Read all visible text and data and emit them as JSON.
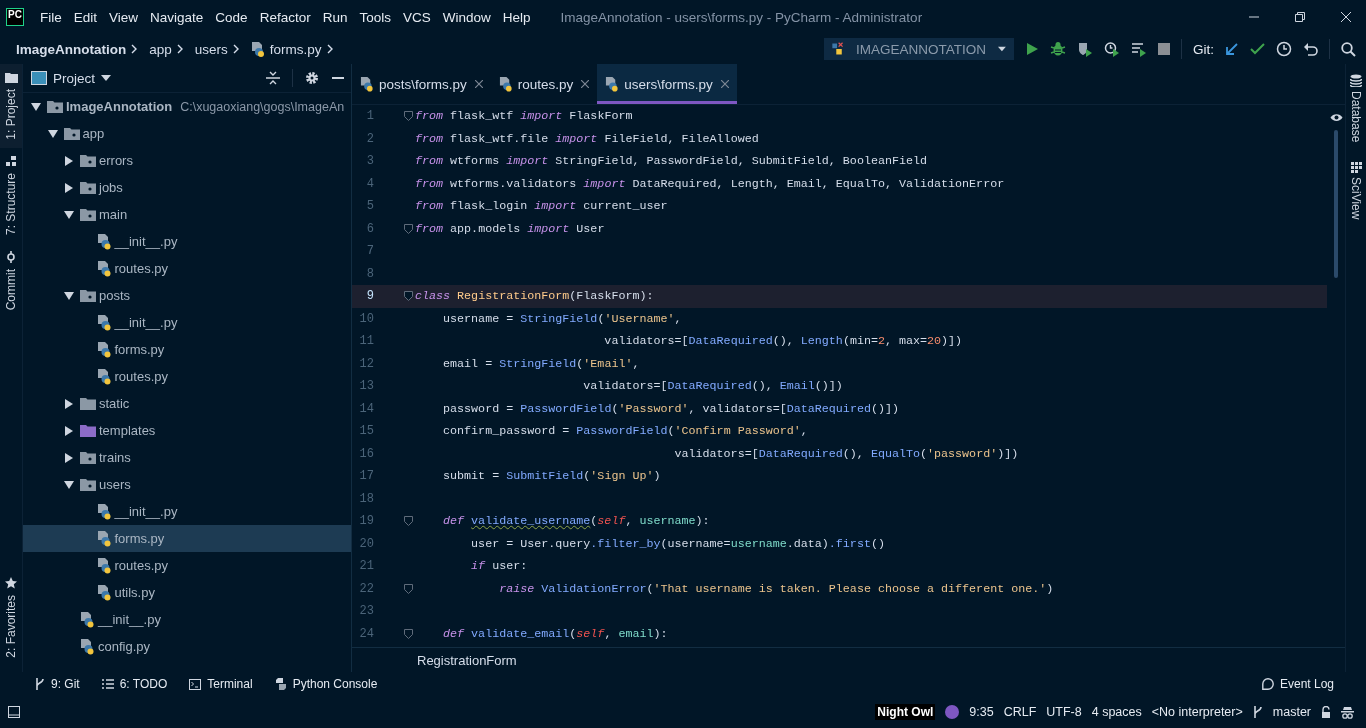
{
  "window": {
    "logo": "PC",
    "title": "ImageAnnotation - users\\forms.py - PyCharm - Administrator"
  },
  "menu": [
    "File",
    "Edit",
    "View",
    "Navigate",
    "Code",
    "Refactor",
    "Run",
    "Tools",
    "VCS",
    "Window",
    "Help"
  ],
  "breadcrumbs": [
    {
      "text": "ImageAnnotation",
      "kind": "project"
    },
    {
      "text": "app",
      "kind": "folder"
    },
    {
      "text": "users",
      "kind": "folder"
    },
    {
      "text": "forms.py",
      "kind": "py"
    }
  ],
  "run_config": "IMAGEANNOTATION",
  "git_label": "Git:",
  "left_strip": [
    {
      "label": "1: Project",
      "kind": "folder",
      "selected": true
    },
    {
      "label": "7: Structure",
      "kind": "structure",
      "selected": false
    },
    {
      "label": "Commit",
      "kind": "commit",
      "selected": false
    }
  ],
  "left_strip_bottom": [
    {
      "label": "2: Favorites",
      "kind": "star",
      "selected": false
    }
  ],
  "right_strip": [
    {
      "label": "Database",
      "kind": "database"
    },
    {
      "label": "SciView",
      "kind": "sciview"
    }
  ],
  "project": {
    "title": "Project",
    "tree": [
      {
        "name": "ImageAnnotation",
        "path": "C:\\xugaoxiang\\gogs\\ImageAn",
        "kind": "root",
        "expanded": true,
        "selected": false,
        "children": [
          {
            "name": "app",
            "kind": "package",
            "expanded": true,
            "selected": false,
            "children": [
              {
                "name": "errors",
                "kind": "package",
                "expanded": false,
                "selected": false
              },
              {
                "name": "jobs",
                "kind": "package",
                "expanded": false,
                "selected": false
              },
              {
                "name": "main",
                "kind": "package",
                "expanded": true,
                "selected": false,
                "children": [
                  {
                    "name": "__init__.py",
                    "kind": "py",
                    "selected": false
                  },
                  {
                    "name": "routes.py",
                    "kind": "py",
                    "selected": false
                  }
                ]
              },
              {
                "name": "posts",
                "kind": "package",
                "expanded": true,
                "selected": false,
                "children": [
                  {
                    "name": "__init__.py",
                    "kind": "py",
                    "selected": false
                  },
                  {
                    "name": "forms.py",
                    "kind": "py",
                    "selected": false
                  },
                  {
                    "name": "routes.py",
                    "kind": "py",
                    "selected": false
                  }
                ]
              },
              {
                "name": "static",
                "kind": "folder",
                "expanded": false,
                "selected": false
              },
              {
                "name": "templates",
                "kind": "template",
                "expanded": false,
                "selected": false
              },
              {
                "name": "trains",
                "kind": "package",
                "expanded": false,
                "selected": false
              },
              {
                "name": "users",
                "kind": "package",
                "expanded": true,
                "selected": false,
                "children": [
                  {
                    "name": "__init__.py",
                    "kind": "py",
                    "selected": false
                  },
                  {
                    "name": "forms.py",
                    "kind": "py",
                    "selected": true
                  },
                  {
                    "name": "routes.py",
                    "kind": "py",
                    "selected": false
                  },
                  {
                    "name": "utils.py",
                    "kind": "py",
                    "selected": false
                  }
                ]
              },
              {
                "name": "__init__.py",
                "kind": "py",
                "selected": false
              },
              {
                "name": "config.py",
                "kind": "py",
                "selected": false
              }
            ]
          }
        ]
      }
    ]
  },
  "tabs": [
    {
      "label": "posts\\forms.py",
      "selected": false
    },
    {
      "label": "routes.py",
      "selected": false
    },
    {
      "label": "users\\forms.py",
      "selected": true
    }
  ],
  "code": [
    {
      "num": "1",
      "current": false,
      "fold": true,
      "tokens": [
        {
          "kind": "kw",
          "text": "from"
        },
        {
          "kind": "plain",
          "text": " flask_wtf "
        },
        {
          "kind": "kw",
          "text": "import"
        },
        {
          "kind": "plain",
          "text": " FlaskForm"
        }
      ]
    },
    {
      "num": "2",
      "current": false,
      "fold": false,
      "tokens": [
        {
          "kind": "kw",
          "text": "from"
        },
        {
          "kind": "plain",
          "text": " flask_wtf.file "
        },
        {
          "kind": "kw",
          "text": "import"
        },
        {
          "kind": "plain",
          "text": " FileField, FileAllowed"
        }
      ]
    },
    {
      "num": "3",
      "current": false,
      "fold": false,
      "tokens": [
        {
          "kind": "kw",
          "text": "from"
        },
        {
          "kind": "plain",
          "text": " wtforms "
        },
        {
          "kind": "kw",
          "text": "import"
        },
        {
          "kind": "plain",
          "text": " StringField, PasswordField, SubmitField, BooleanField"
        }
      ]
    },
    {
      "num": "4",
      "current": false,
      "fold": false,
      "tokens": [
        {
          "kind": "kw",
          "text": "from"
        },
        {
          "kind": "plain",
          "text": " wtforms.validators "
        },
        {
          "kind": "kw",
          "text": "import"
        },
        {
          "kind": "plain",
          "text": " DataRequired, Length, Email, EqualTo, ValidationError"
        }
      ]
    },
    {
      "num": "5",
      "current": false,
      "fold": false,
      "tokens": [
        {
          "kind": "kw",
          "text": "from"
        },
        {
          "kind": "plain",
          "text": " flask_login "
        },
        {
          "kind": "kw",
          "text": "import"
        },
        {
          "kind": "plain",
          "text": " current_user"
        }
      ]
    },
    {
      "num": "6",
      "current": false,
      "fold": true,
      "tokens": [
        {
          "kind": "kw",
          "text": "from"
        },
        {
          "kind": "plain",
          "text": " app.models "
        },
        {
          "kind": "kw",
          "text": "import"
        },
        {
          "kind": "plain",
          "text": " User"
        }
      ]
    },
    {
      "num": "7",
      "current": false,
      "fold": false
    },
    {
      "num": "8",
      "current": false,
      "fold": false
    },
    {
      "num": "9",
      "current": true,
      "fold": true,
      "tokens": [
        {
          "kind": "kw",
          "text": "class "
        },
        {
          "kind": "cls",
          "text": "RegistrationForm"
        },
        {
          "kind": "plain",
          "text": "(FlaskForm):"
        }
      ]
    },
    {
      "num": "10",
      "current": false,
      "fold": false,
      "tokens": [
        {
          "kind": "plain",
          "text": "    username = "
        },
        {
          "kind": "fn",
          "text": "StringField"
        },
        {
          "kind": "plain",
          "text": "("
        },
        {
          "kind": "str",
          "text": "'Username'"
        },
        {
          "kind": "plain",
          "text": ","
        }
      ]
    },
    {
      "num": "11",
      "current": false,
      "fold": false,
      "tokens": [
        {
          "kind": "plain",
          "text": "                           validators=["
        },
        {
          "kind": "fn",
          "text": "DataRequired"
        },
        {
          "kind": "plain",
          "text": "(), "
        },
        {
          "kind": "fn",
          "text": "Length"
        },
        {
          "kind": "plain",
          "text": "(min="
        },
        {
          "kind": "num",
          "text": "2"
        },
        {
          "kind": "plain",
          "text": ", max="
        },
        {
          "kind": "num",
          "text": "20"
        },
        {
          "kind": "plain",
          "text": ")])"
        }
      ]
    },
    {
      "num": "12",
      "current": false,
      "fold": false,
      "tokens": [
        {
          "kind": "plain",
          "text": "    email = "
        },
        {
          "kind": "fn",
          "text": "StringField"
        },
        {
          "kind": "plain",
          "text": "("
        },
        {
          "kind": "str",
          "text": "'Email'"
        },
        {
          "kind": "plain",
          "text": ","
        }
      ]
    },
    {
      "num": "13",
      "current": false,
      "fold": false,
      "tokens": [
        {
          "kind": "plain",
          "text": "                        validators=["
        },
        {
          "kind": "fn",
          "text": "DataRequired"
        },
        {
          "kind": "plain",
          "text": "(), "
        },
        {
          "kind": "fn",
          "text": "Email"
        },
        {
          "kind": "plain",
          "text": "()])"
        }
      ]
    },
    {
      "num": "14",
      "current": false,
      "fold": false,
      "tokens": [
        {
          "kind": "plain",
          "text": "    password = "
        },
        {
          "kind": "fn",
          "text": "PasswordField"
        },
        {
          "kind": "plain",
          "text": "("
        },
        {
          "kind": "str",
          "text": "'Password'"
        },
        {
          "kind": "plain",
          "text": ", validators=["
        },
        {
          "kind": "fn",
          "text": "DataRequired"
        },
        {
          "kind": "plain",
          "text": "()])"
        }
      ]
    },
    {
      "num": "15",
      "current": false,
      "fold": false,
      "tokens": [
        {
          "kind": "plain",
          "text": "    confirm_password = "
        },
        {
          "kind": "fn",
          "text": "PasswordField"
        },
        {
          "kind": "plain",
          "text": "("
        },
        {
          "kind": "str",
          "text": "'Confirm Password'"
        },
        {
          "kind": "plain",
          "text": ","
        }
      ]
    },
    {
      "num": "16",
      "current": false,
      "fold": false,
      "tokens": [
        {
          "kind": "plain",
          "text": "                                     validators=["
        },
        {
          "kind": "fn",
          "text": "DataRequired"
        },
        {
          "kind": "plain",
          "text": "(), "
        },
        {
          "kind": "fn",
          "text": "EqualTo"
        },
        {
          "kind": "plain",
          "text": "("
        },
        {
          "kind": "str",
          "text": "'password'"
        },
        {
          "kind": "plain",
          "text": ")])"
        }
      ]
    },
    {
      "num": "17",
      "current": false,
      "fold": false,
      "tokens": [
        {
          "kind": "plain",
          "text": "    submit = "
        },
        {
          "kind": "fn",
          "text": "SubmitField"
        },
        {
          "kind": "plain",
          "text": "("
        },
        {
          "kind": "str",
          "text": "'Sign Up'"
        },
        {
          "kind": "plain",
          "text": ")"
        }
      ]
    },
    {
      "num": "18",
      "current": false,
      "fold": false
    },
    {
      "num": "19",
      "current": false,
      "fold": true,
      "tokens": [
        {
          "kind": "kw",
          "text": "    def "
        },
        {
          "kind": "warn",
          "text": "validate_username"
        },
        {
          "kind": "plain",
          "text": "("
        },
        {
          "kind": "self",
          "text": "self"
        },
        {
          "kind": "plain",
          "text": ", "
        },
        {
          "kind": "param",
          "text": "username"
        },
        {
          "kind": "plain",
          "text": "):"
        }
      ]
    },
    {
      "num": "20",
      "current": false,
      "fold": false,
      "tokens": [
        {
          "kind": "plain",
          "text": "        user = User.query"
        },
        {
          "kind": "fn",
          "text": ".filter_by"
        },
        {
          "kind": "plain",
          "text": "(username="
        },
        {
          "kind": "param",
          "text": "username"
        },
        {
          "kind": "plain",
          "text": ".data)"
        },
        {
          "kind": "fn",
          "text": ".first"
        },
        {
          "kind": "plain",
          "text": "()"
        }
      ]
    },
    {
      "num": "21",
      "current": false,
      "fold": false,
      "tokens": [
        {
          "kind": "kw",
          "text": "        if"
        },
        {
          "kind": "plain",
          "text": " user:"
        }
      ]
    },
    {
      "num": "22",
      "current": false,
      "fold": true,
      "tokens": [
        {
          "kind": "kw",
          "text": "            raise "
        },
        {
          "kind": "fn",
          "text": "ValidationError"
        },
        {
          "kind": "plain",
          "text": "("
        },
        {
          "kind": "str",
          "text": "'That username is taken. Please choose a different one.'"
        },
        {
          "kind": "plain",
          "text": ")"
        }
      ]
    },
    {
      "num": "23",
      "current": false,
      "fold": false
    },
    {
      "num": "24",
      "current": false,
      "fold": true,
      "tokens": [
        {
          "kind": "kw",
          "text": "    def "
        },
        {
          "kind": "fn",
          "text": "validate_email"
        },
        {
          "kind": "plain",
          "text": "("
        },
        {
          "kind": "self",
          "text": "self"
        },
        {
          "kind": "plain",
          "text": ", "
        },
        {
          "kind": "param",
          "text": "email"
        },
        {
          "kind": "plain",
          "text": "):"
        }
      ]
    }
  ],
  "editor_breadcrumb": "RegistrationForm",
  "tool_buttons": [
    {
      "label": "9: Git",
      "kind": "git"
    },
    {
      "label": "6: TODO",
      "kind": "todo"
    },
    {
      "label": "Terminal",
      "kind": "terminal"
    },
    {
      "label": "Python Console",
      "kind": "python"
    }
  ],
  "event_log": "Event Log",
  "status_bar": {
    "theme": "Night Owl",
    "position": "9:35",
    "line_sep": "CRLF",
    "encoding": "UTF-8",
    "indent": "4 spaces",
    "interpreter": "<No interpreter>",
    "branch": "master"
  }
}
